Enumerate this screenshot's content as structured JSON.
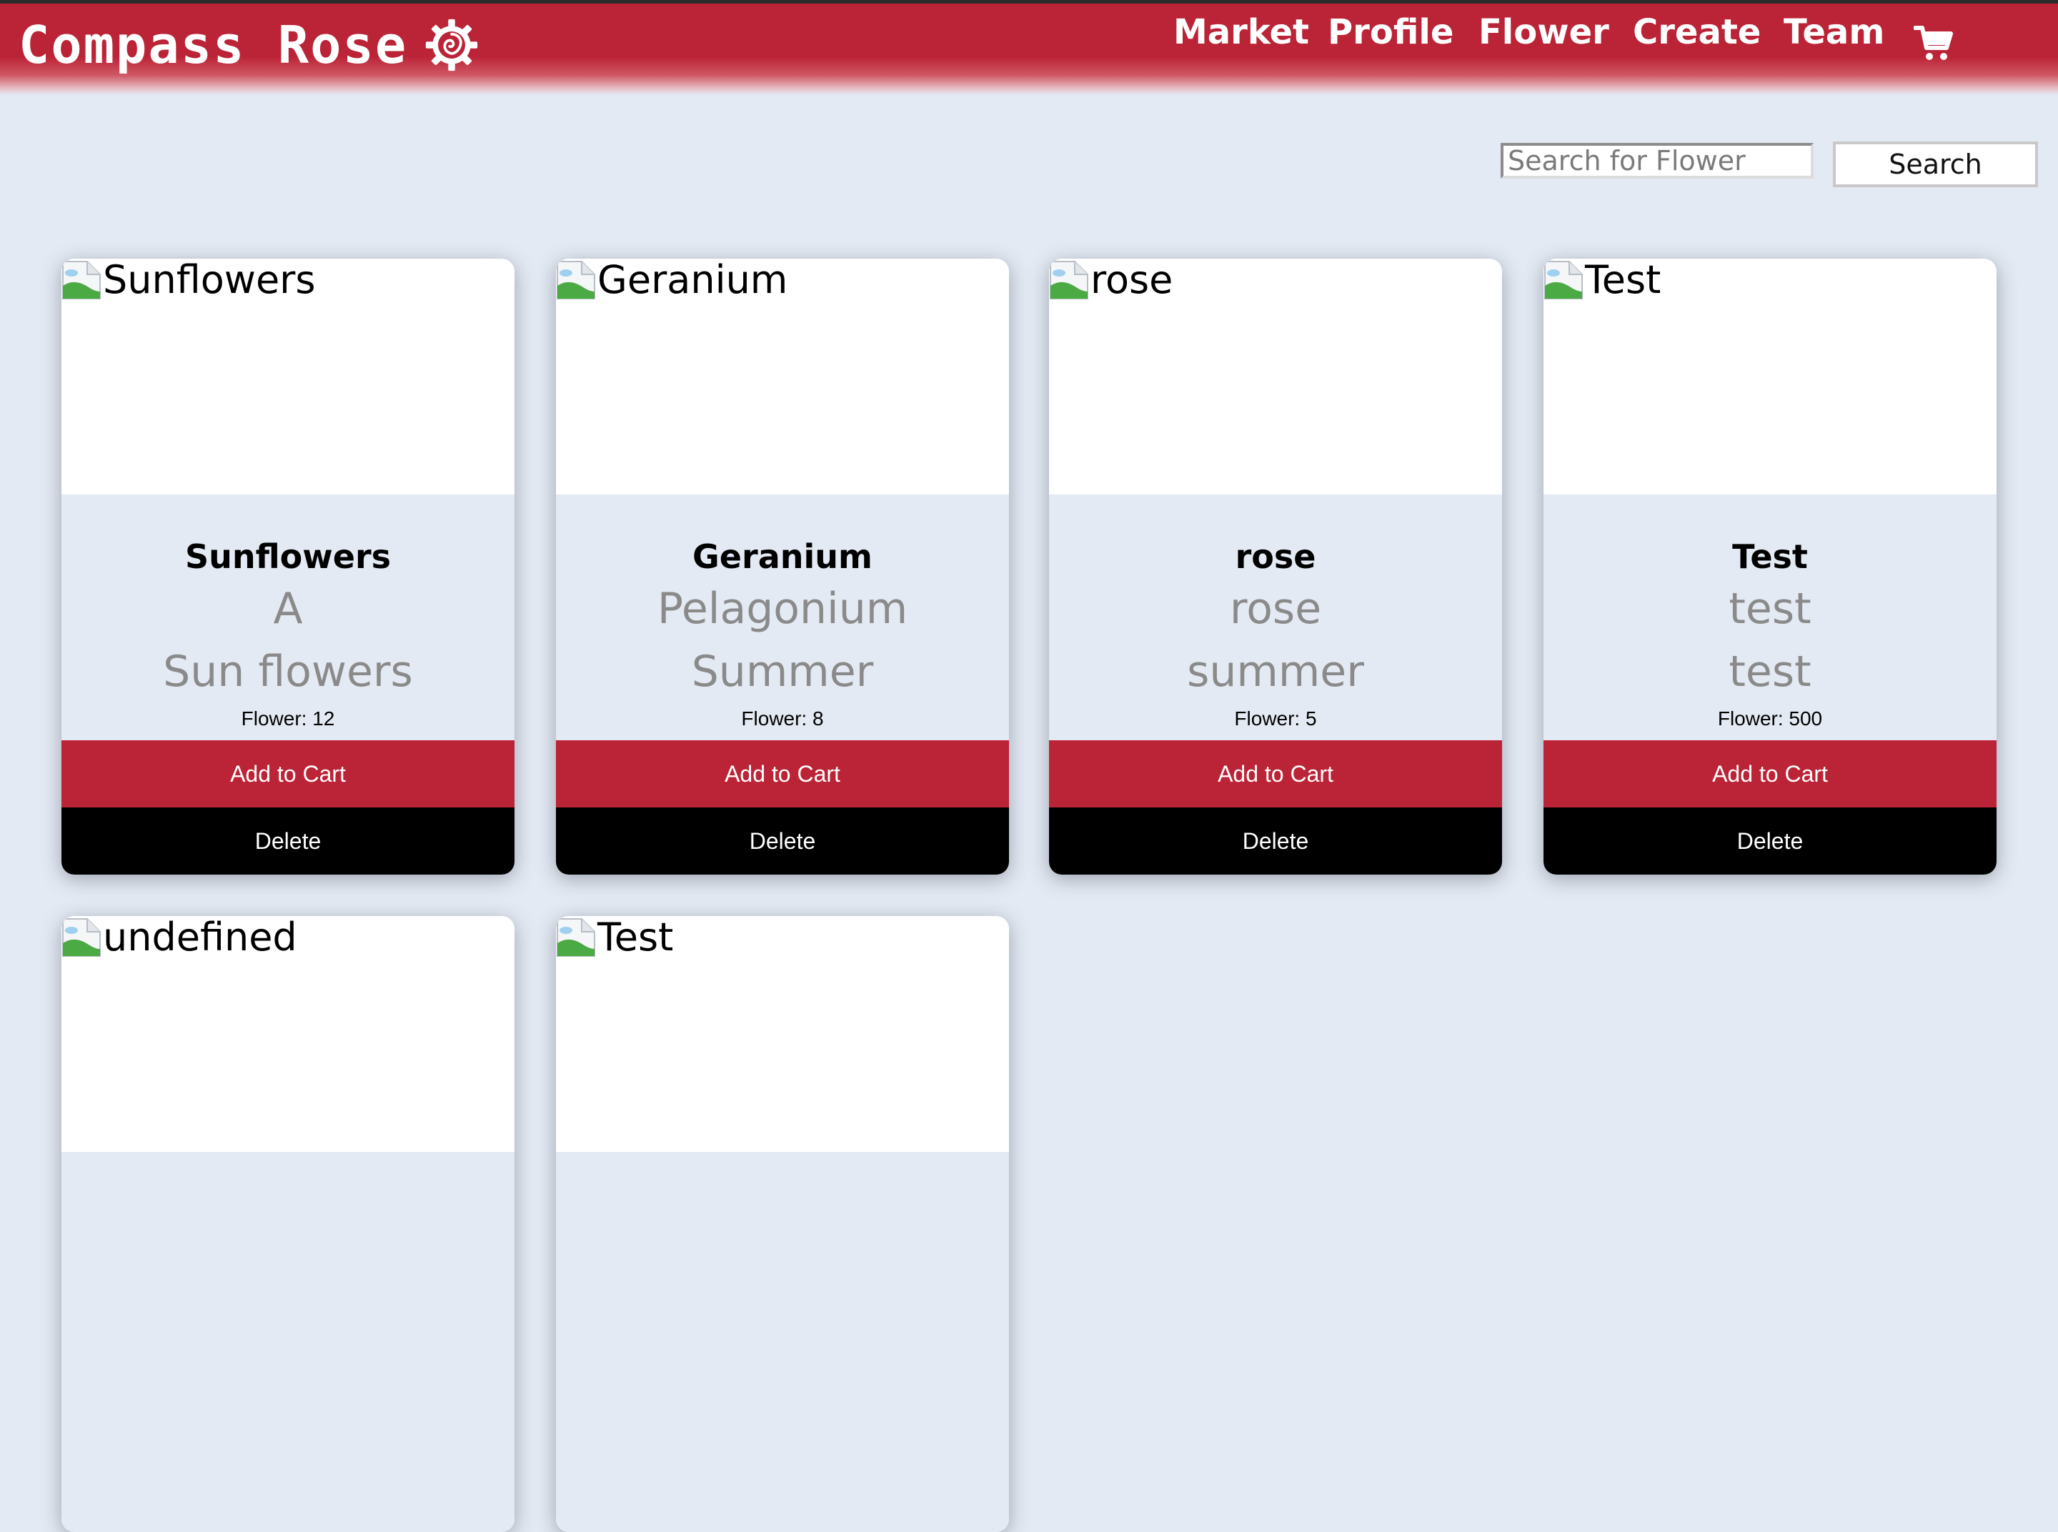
{
  "brand": {
    "name": "Compass Rose",
    "logo_icon": "rose-gear-icon"
  },
  "nav": {
    "links": [
      "Market",
      "Profile",
      "Flower",
      "Create",
      "Team"
    ],
    "cart_icon": "shopping-cart-icon"
  },
  "search": {
    "placeholder": "Search for Flower",
    "value": "",
    "button_label": "Search"
  },
  "cards": [
    {
      "alt": "Sunflowers",
      "title": "Sunflowers",
      "line1": "A",
      "line2": "Sun flowers",
      "count": "Flower: 12",
      "add_label": "Add to Cart",
      "delete_label": "Delete"
    },
    {
      "alt": "Geranium",
      "title": "Geranium",
      "line1": "Pelagonium",
      "line2": "Summer",
      "count": "Flower: 8",
      "add_label": "Add to Cart",
      "delete_label": "Delete"
    },
    {
      "alt": "rose",
      "title": "rose",
      "line1": "rose",
      "line2": "summer",
      "count": "Flower: 5",
      "add_label": "Add to Cart",
      "delete_label": "Delete"
    },
    {
      "alt": "Test",
      "title": "Test",
      "line1": "test",
      "line2": "test",
      "count": "Flower: 500",
      "add_label": "Add to Cart",
      "delete_label": "Delete"
    },
    {
      "alt": "undefined"
    },
    {
      "alt": "Test"
    }
  ],
  "colors": {
    "accent": "#bb2336",
    "background": "#e4eaf3",
    "delete": "#000000"
  }
}
